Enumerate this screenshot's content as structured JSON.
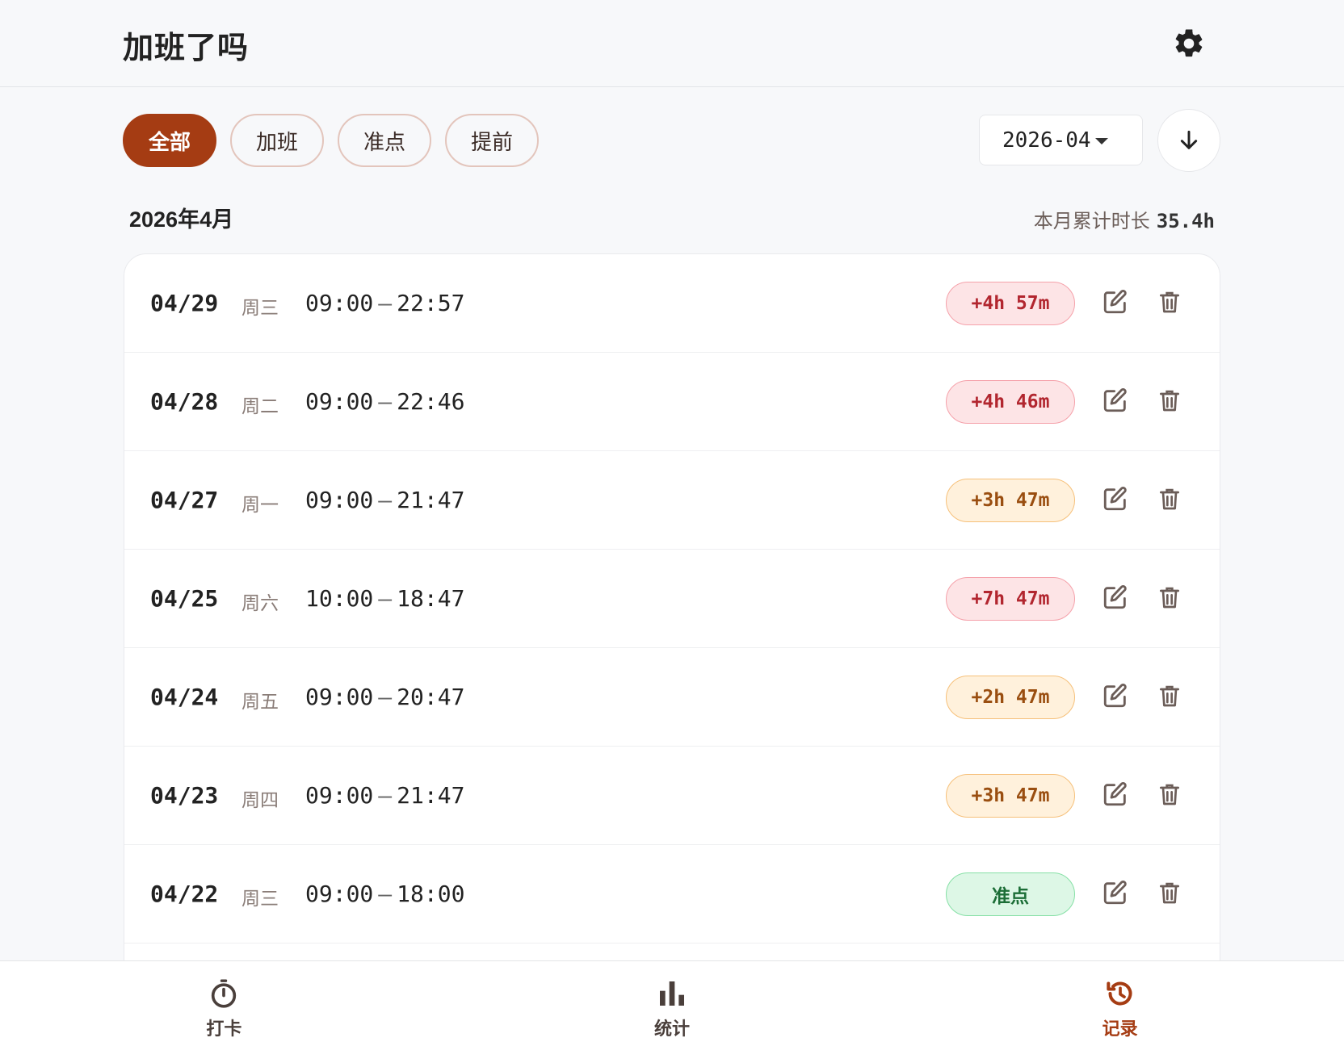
{
  "header": {
    "title": "加班了吗",
    "settings_icon": "gear-icon"
  },
  "filters": [
    {
      "label": "全部",
      "active": true
    },
    {
      "label": "加班",
      "active": false
    },
    {
      "label": "准点",
      "active": false
    },
    {
      "label": "提前",
      "active": false
    }
  ],
  "month_select": {
    "value": "2026-04",
    "icon": "caret-down-icon"
  },
  "sort_button": {
    "icon": "arrow-down-icon"
  },
  "summary": {
    "month_title": "2026年4月",
    "total_label": "本月累计时长",
    "total_value": "35.4h"
  },
  "records": [
    {
      "date": "04/29",
      "weekday": "周三",
      "start": "09:00",
      "end": "22:57",
      "badge": "+4h 57m",
      "status": "red"
    },
    {
      "date": "04/28",
      "weekday": "周二",
      "start": "09:00",
      "end": "22:46",
      "badge": "+4h 46m",
      "status": "red"
    },
    {
      "date": "04/27",
      "weekday": "周一",
      "start": "09:00",
      "end": "21:47",
      "badge": "+3h 47m",
      "status": "orange"
    },
    {
      "date": "04/25",
      "weekday": "周六",
      "start": "10:00",
      "end": "18:47",
      "badge": "+7h 47m",
      "status": "red"
    },
    {
      "date": "04/24",
      "weekday": "周五",
      "start": "09:00",
      "end": "20:47",
      "badge": "+2h 47m",
      "status": "orange"
    },
    {
      "date": "04/23",
      "weekday": "周四",
      "start": "09:00",
      "end": "21:47",
      "badge": "+3h 47m",
      "status": "orange"
    },
    {
      "date": "04/22",
      "weekday": "周三",
      "start": "09:00",
      "end": "18:00",
      "badge": "准点",
      "status": "green"
    }
  ],
  "time_separator": "–",
  "colors": {
    "accent": "#a53c13",
    "overtime_red": "#b2262f",
    "overtime_orange": "#9a4e10",
    "ontime_green": "#1c6e37"
  },
  "bottom_nav": [
    {
      "label": "打卡",
      "icon": "stopwatch-icon",
      "active": false
    },
    {
      "label": "统计",
      "icon": "bar-chart-icon",
      "active": false
    },
    {
      "label": "记录",
      "icon": "history-icon",
      "active": true
    }
  ]
}
